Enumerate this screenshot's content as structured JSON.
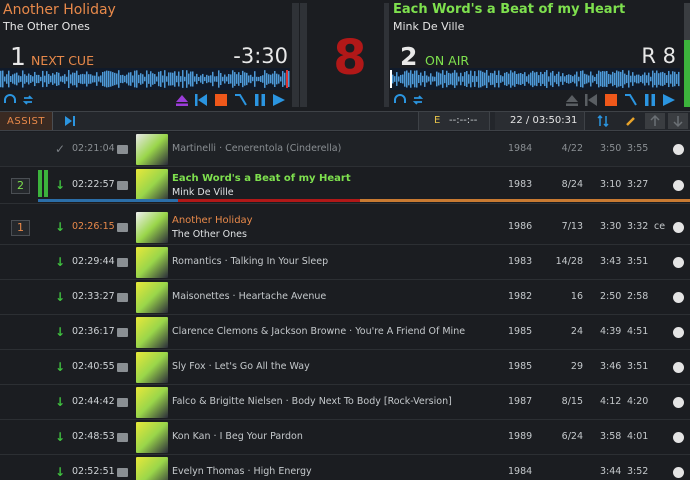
{
  "deckA": {
    "title": "Another Holiday",
    "artist": "The Other Ones",
    "number": "1",
    "state": "NEXT CUE",
    "remaining": "-3:30",
    "title_color": "#e8894a"
  },
  "deckB": {
    "title": "Each Word's a Beat of my Heart",
    "artist": "Mink De Ville",
    "number": "2",
    "state": "ON AIR",
    "remaining": "R 8",
    "title_color": "#7ee04e"
  },
  "center": {
    "big_number": "8"
  },
  "toolbar": {
    "assist_label": "ASSIST",
    "e_label": "E",
    "e_value": "--:--:--",
    "count_label": "22 / 03:50:31"
  },
  "icons": {
    "headphones": "headphones-icon",
    "loop": "loop-icon",
    "eject": "eject-icon",
    "prev": "skip-back-icon",
    "stop": "stop-icon",
    "fade": "fade-icon",
    "pause": "pause-icon",
    "play": "play-icon"
  },
  "playlist": [
    {
      "time": "02:21:04",
      "line1": "Martinelli · Cenerentola (Cinderella)",
      "year": "1984",
      "bpm": "4/22",
      "d1": "3:50",
      "d2": "3:55",
      "extra": "",
      "status": "played"
    },
    {
      "time": "02:22:57",
      "line1": "Each Word's a Beat of my Heart",
      "line2": "Mink De Ville",
      "year": "1983",
      "bpm": "8/24",
      "d1": "3:10",
      "d2": "3:27",
      "extra": "",
      "status": "onair",
      "deck": "2"
    },
    {
      "time": "02:26:15",
      "line1": "Another Holiday",
      "line2": "The Other Ones",
      "year": "1986",
      "bpm": "7/13",
      "d1": "3:30",
      "d2": "3:32",
      "extra": "ce",
      "status": "cued",
      "deck": "1"
    },
    {
      "time": "02:29:44",
      "line1": "Romantics · Talking In Your Sleep",
      "year": "1983",
      "bpm": "14/28",
      "d1": "3:43",
      "d2": "3:51",
      "extra": "",
      "status": "queued"
    },
    {
      "time": "02:33:27",
      "line1": "Maisonettes · Heartache Avenue",
      "year": "1982",
      "bpm": "16",
      "d1": "2:50",
      "d2": "2:58",
      "extra": "",
      "status": "queued"
    },
    {
      "time": "02:36:17",
      "line1": "Clarence Clemons & Jackson Browne · You're A Friend Of Mine",
      "year": "1985",
      "bpm": "24",
      "d1": "4:39",
      "d2": "4:51",
      "extra": "",
      "status": "queued"
    },
    {
      "time": "02:40:55",
      "line1": "Sly Fox · Let's Go All the Way",
      "year": "1985",
      "bpm": "29",
      "d1": "3:46",
      "d2": "3:51",
      "extra": "",
      "status": "queued"
    },
    {
      "time": "02:44:42",
      "line1": "Falco & Brigitte Nielsen · Body Next To Body [Rock-Version]",
      "year": "1987",
      "bpm": "8/15",
      "d1": "4:12",
      "d2": "4:20",
      "extra": "",
      "status": "queued"
    },
    {
      "time": "02:48:53",
      "line1": "Kon Kan · I Beg Your Pardon",
      "year": "1989",
      "bpm": "6/24",
      "d1": "3:58",
      "d2": "4:01",
      "extra": "",
      "status": "queued"
    },
    {
      "time": "02:52:51",
      "line1": "Evelyn Thomas · High Energy",
      "year": "1984",
      "bpm": "",
      "d1": "3:44",
      "d2": "3:52",
      "extra": "",
      "status": "queued"
    }
  ]
}
